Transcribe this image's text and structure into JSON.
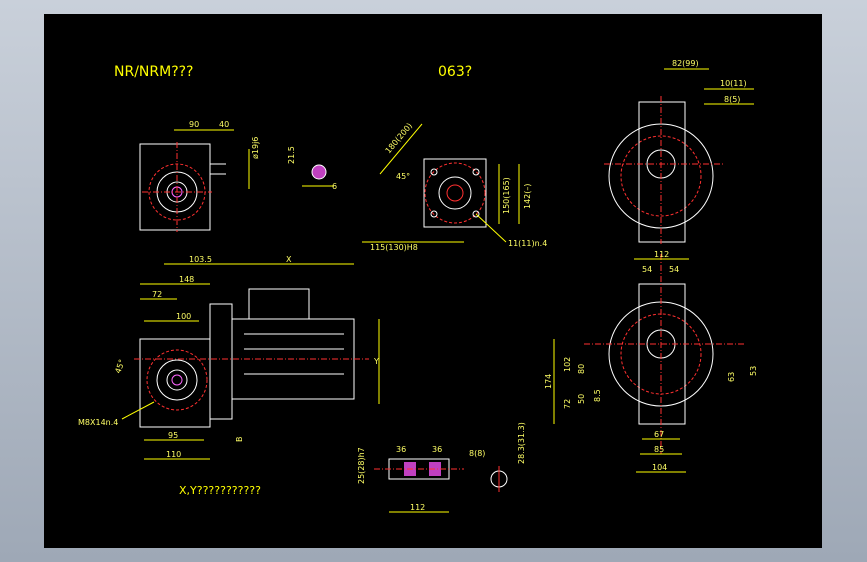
{
  "drawing": {
    "title_left": "NR/NRM???",
    "title_center": "063?",
    "note_bottom": "X,Y???????????"
  },
  "colors": {
    "background": "#000000",
    "frame": "#a8b2c0",
    "part": "#ffffff",
    "dimension": "#ffff00",
    "text_dim": "#ffff66",
    "accent": "#ff3030",
    "gear": "#ff66ff",
    "line_alt": "#00ffff"
  },
  "dims": {
    "top_90": "90",
    "top_40": "40",
    "shaft_d": "ø19j6",
    "key_215": "21.5",
    "key_6": "6",
    "flange_diag": "180(200)",
    "flange_45": "45°",
    "flange_150": "150(165)",
    "flange_142": "142(–)",
    "flange_pilot": "115(130)H8",
    "flange_holes": "11(11)n.4",
    "side_82": "82(99)",
    "side_10": "10(11)",
    "side_8": "8(5)",
    "x_1035": "103.5",
    "x_label": "X",
    "d_148": "148",
    "d_72": "72",
    "d_100": "100",
    "d_45": "45°",
    "d_m8": "M8X14n.4",
    "d_95": "95",
    "d_110": "110",
    "d_B": "B",
    "y_label": "Y",
    "fr_112": "112",
    "fr_54a": "54",
    "fr_54b": "54",
    "fr_174": "174",
    "fr_102": "102",
    "fr_80": "80",
    "fr_72": "72",
    "fr_50": "50",
    "fr_85": "8.5",
    "fr_67": "67",
    "fr_85b": "85",
    "fr_104": "104",
    "fr_63": "63",
    "fr_53": "53",
    "sh_25": "25(28)h7",
    "sh_36a": "36",
    "sh_36b": "36",
    "sh_112": "112",
    "sk_8": "8(8)",
    "sk_283": "28.3(31.3)"
  }
}
